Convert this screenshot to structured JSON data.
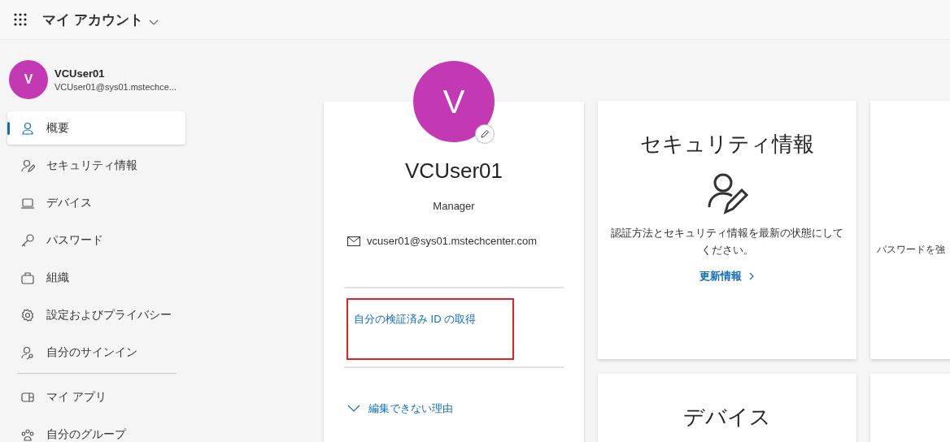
{
  "header": {
    "title": "マイ アカウント"
  },
  "user": {
    "initial": "V",
    "name": "VCUser01",
    "email": "VCUser01@sys01.mstechce..."
  },
  "nav": [
    {
      "label": "概要",
      "selected": true
    },
    {
      "label": "セキュリティ情報",
      "selected": false
    },
    {
      "label": "デバイス",
      "selected": false
    },
    {
      "label": "パスワード",
      "selected": false
    },
    {
      "label": "組織",
      "selected": false
    },
    {
      "label": "設定およびプライバシー",
      "selected": false
    },
    {
      "label": "自分のサインイン",
      "selected": false
    }
  ],
  "nav_more": [
    {
      "label": "マイ アプリ",
      "selected": false
    },
    {
      "label": "自分のグループ",
      "selected": false
    }
  ],
  "profile": {
    "initial": "V",
    "name": "VCUser01",
    "job_title": "Manager",
    "email": "vcuser01@sys01.mstechcenter.com",
    "link": "自分の検証済み ID の取得",
    "link_highlighted": true,
    "expander": {
      "label": "編集できない理由",
      "expanded": false
    }
  },
  "cards": [
    {
      "title": "セキュリティ情報",
      "description": "認証方法とセキュリティ情報を最新の状態にしてください。",
      "link": "更新情報"
    },
    {
      "description": "パスワードを強"
    },
    {
      "title": "デバイス"
    }
  ]
}
